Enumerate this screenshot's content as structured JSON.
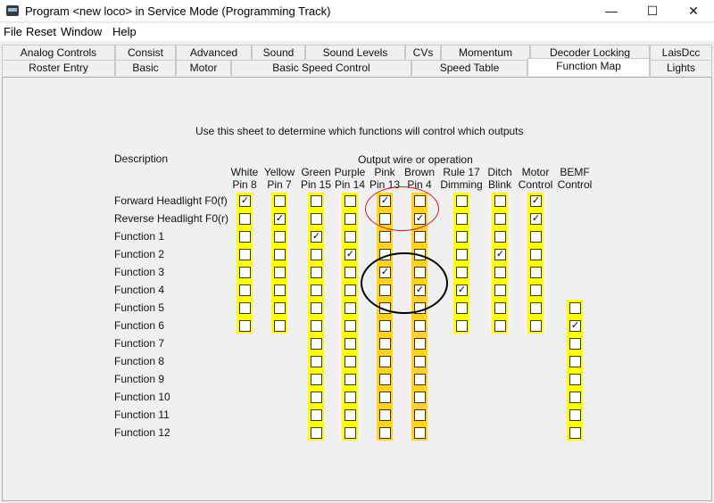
{
  "window": {
    "title": "Program <new loco> in Service Mode (Programming Track)",
    "minimize_glyph": "—",
    "maximize_glyph": "☐",
    "close_glyph": "✕"
  },
  "menu": [
    "File",
    "Reset",
    "Window",
    "Help"
  ],
  "tabs_row1": [
    "Analog Controls",
    "Consist",
    "Advanced",
    "Sound",
    "Sound Levels",
    "CVs",
    "Momentum",
    "Decoder Locking",
    "LaisDcc"
  ],
  "tabs_row2": [
    "Roster Entry",
    "Basic",
    "Motor",
    "Basic Speed Control",
    "Speed Table",
    "Function Map",
    "Lights"
  ],
  "selected_tab": "Function Map",
  "instruction": "Use this sheet to determine which functions will control which outputs",
  "description_header": "Description",
  "outputs_header": "Output wire or operation",
  "columns": [
    {
      "line1": "White",
      "line2": "Pin 8",
      "color": "yellow",
      "rows": 8
    },
    {
      "line1": "Yellow",
      "line2": "Pin 7",
      "color": "yellow",
      "rows": 8
    },
    {
      "line1": "Green",
      "line2": "Pin 15",
      "color": "yellow",
      "rows": 14
    },
    {
      "line1": "Purple",
      "line2": "Pin 14",
      "color": "yellow",
      "rows": 14
    },
    {
      "line1": "Pink",
      "line2": "Pin 13",
      "color": "orange",
      "rows": 14
    },
    {
      "line1": "Brown",
      "line2": "Pin 4",
      "color": "orange",
      "rows": 14
    },
    {
      "line1": "Rule 17",
      "line2": "Dimming",
      "color": "yellow",
      "rows": 8
    },
    {
      "line1": "Ditch",
      "line2": "Blink",
      "color": "yellow",
      "rows": 8
    },
    {
      "line1": "Motor",
      "line2": "Control",
      "color": "yellow",
      "rows": 8
    },
    {
      "line1": "BEMF",
      "line2": "Control",
      "color": "yellow",
      "rows": 14,
      "offset": 6
    }
  ],
  "rows": [
    "Forward Headlight F0(f)",
    "Reverse Headlight F0(r)",
    "Function 1",
    "Function 2",
    "Function 3",
    "Function 4",
    "Function 5",
    "Function 6",
    "Function 7",
    "Function 8",
    "Function 9",
    "Function 10",
    "Function 11",
    "Function 12"
  ],
  "checked": [
    [
      0,
      0
    ],
    [
      1,
      1
    ],
    [
      2,
      2
    ],
    [
      3,
      3
    ],
    [
      4,
      4
    ],
    [
      5,
      5
    ],
    [
      0,
      4
    ],
    [
      1,
      5
    ],
    [
      0,
      8
    ],
    [
      1,
      8
    ],
    [
      2,
      2
    ],
    [
      3,
      7
    ],
    [
      5,
      6
    ],
    [
      7,
      9
    ]
  ],
  "annotations": {
    "red_color": "#e01515",
    "black_color": "#000000"
  }
}
